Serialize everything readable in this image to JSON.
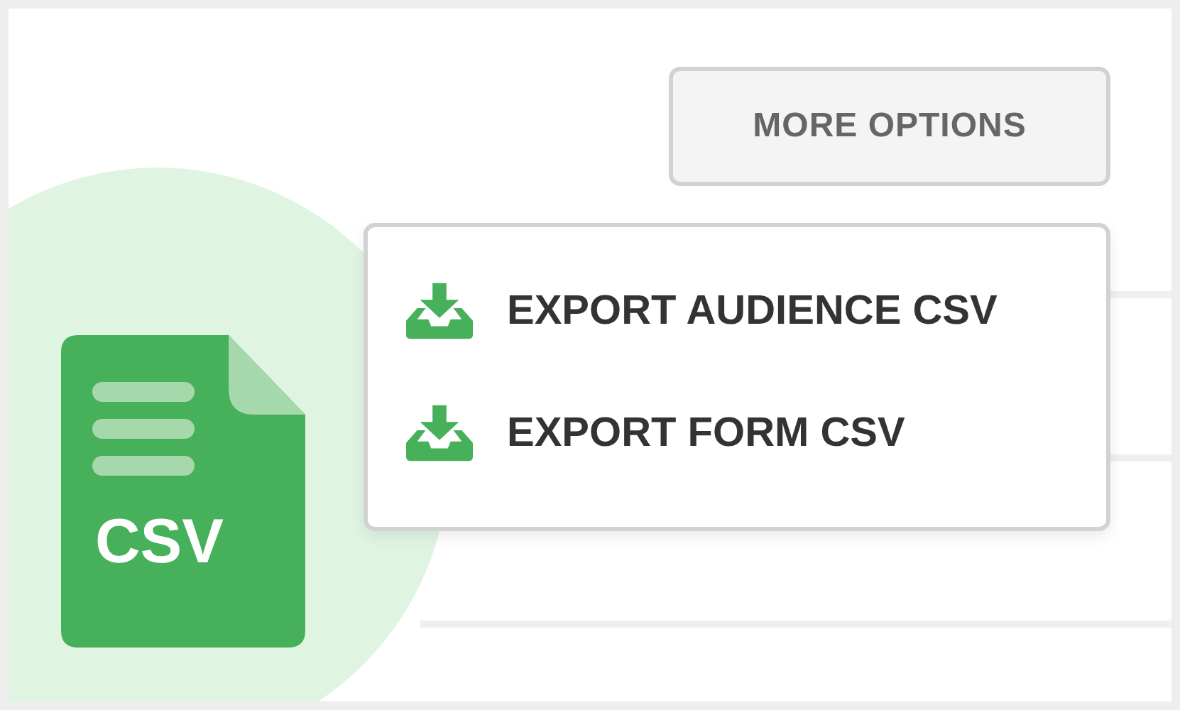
{
  "more_options_button": {
    "label": "MORE OPTIONS"
  },
  "menu": {
    "items": [
      {
        "label": "EXPORT AUDIENCE CSV"
      },
      {
        "label": "EXPORT FORM CSV"
      }
    ]
  },
  "file_icon": {
    "label": "CSV"
  }
}
